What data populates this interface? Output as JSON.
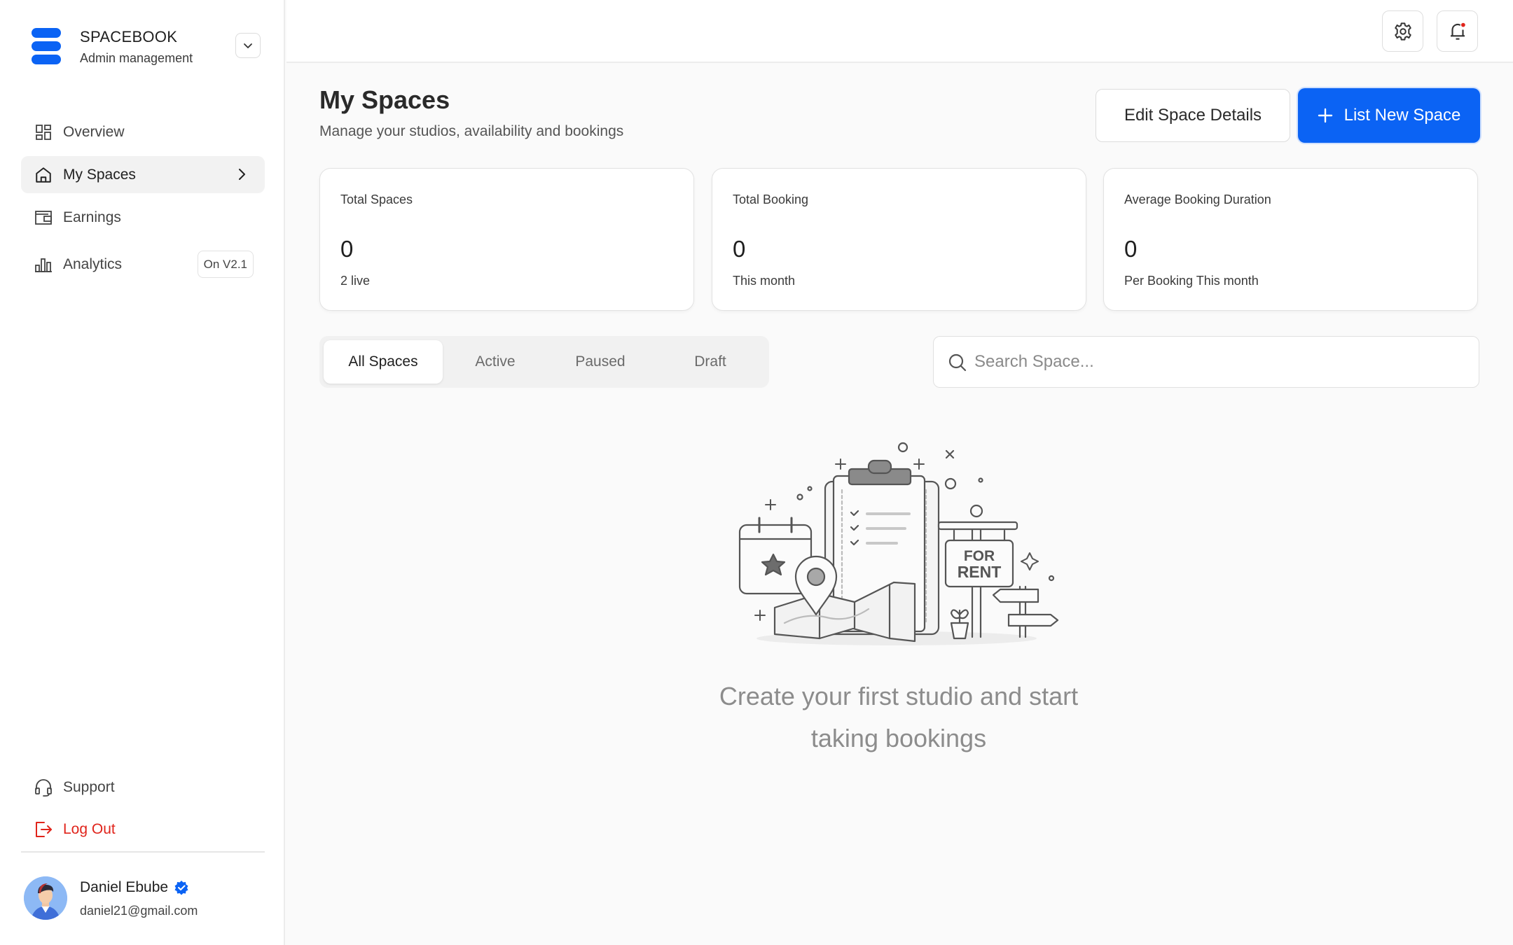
{
  "brand": {
    "name": "SPACEBOOK",
    "subtitle": "Admin management",
    "color": "#0b63f4"
  },
  "sidebar": {
    "items": [
      {
        "label": "Overview",
        "icon": "dashboard-icon"
      },
      {
        "label": "My Spaces",
        "icon": "home-icon",
        "active": true
      },
      {
        "label": "Earnings",
        "icon": "wallet-icon"
      },
      {
        "label": "Analytics",
        "icon": "bar-chart-icon",
        "badge": "On V2.1"
      }
    ],
    "bottom": [
      {
        "label": "Support",
        "icon": "headset-icon"
      },
      {
        "label": "Log Out",
        "icon": "logout-icon",
        "color": "#e0241b"
      }
    ]
  },
  "user": {
    "name": "Daniel Ebube",
    "email": "daniel21@gmail.com",
    "verified": true
  },
  "topbar": {
    "settings_icon": "gear-icon",
    "notifications_icon": "bell-icon",
    "has_notification": true
  },
  "page": {
    "title": "My Spaces",
    "subtitle": "Manage your studios, availability and bookings",
    "edit_button": "Edit Space Details",
    "new_button": "List New Space"
  },
  "stats": [
    {
      "label": "Total Spaces",
      "value": "0",
      "footnote": "2 live"
    },
    {
      "label": "Total Booking",
      "value": "0",
      "footnote": "This month"
    },
    {
      "label": "Average Booking Duration",
      "value": "0",
      "footnote": "Per Booking This month"
    }
  ],
  "tabs": [
    {
      "label": "All Spaces",
      "active": true
    },
    {
      "label": "Active"
    },
    {
      "label": "Paused"
    },
    {
      "label": "Draft"
    }
  ],
  "search": {
    "placeholder": "Search Space..."
  },
  "empty_state": {
    "illustration_sign": [
      "FOR",
      "RENT"
    ],
    "line1": "Create your first studio and start",
    "line2": "taking bookings"
  }
}
